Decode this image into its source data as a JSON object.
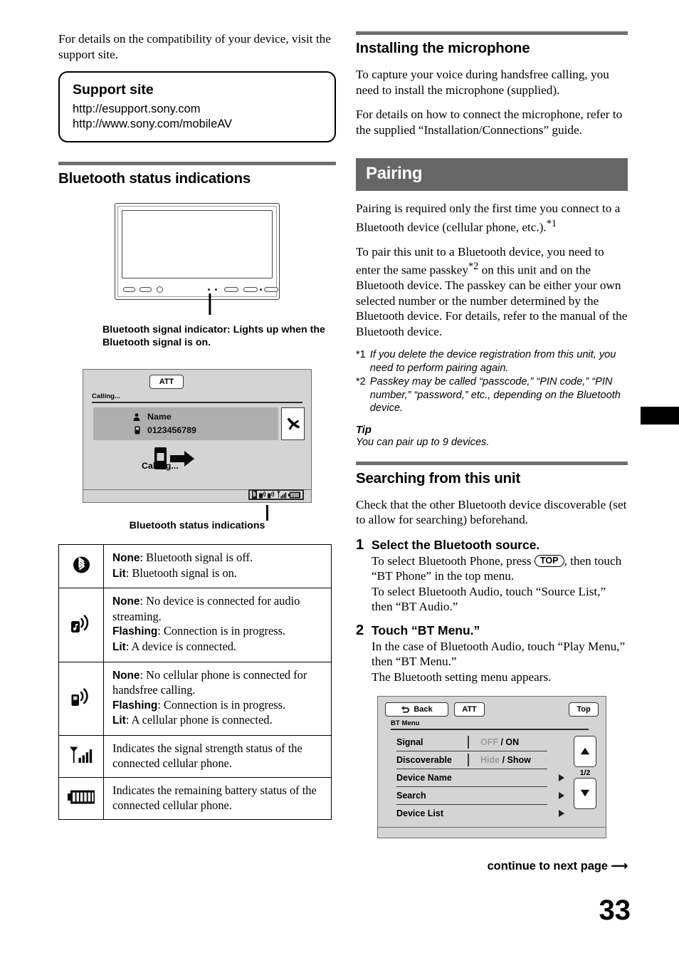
{
  "left": {
    "intro": "For details on the compatibility of your device, visit the support site.",
    "support_box": {
      "title": "Support site",
      "url1": "http://esupport.sony.com",
      "url2": "http://www.sony.com/mobileAV"
    },
    "heading_status": "Bluetooth status indications",
    "unit_caption": "Bluetooth signal indicator: Lights up when the Bluetooth signal is on.",
    "call_screen": {
      "att": "ATT",
      "calling_label": "Calling...",
      "contact_name": "Name",
      "contact_number": "0123456789",
      "calling_word": "Calling..."
    },
    "mock_caption": "Bluetooth status indications",
    "icon_table": [
      {
        "icon": "bluetooth-icon",
        "lines": [
          {
            "bold": "None",
            "rest": ": Bluetooth signal is off."
          },
          {
            "bold": "Lit",
            "rest": ": Bluetooth signal is on."
          }
        ]
      },
      {
        "icon": "bluetooth-audio-streaming-icon",
        "lines": [
          {
            "bold": "None",
            "rest": ": No device is connected for audio streaming."
          },
          {
            "bold": "Flashing",
            "rest": ": Connection is in progress."
          },
          {
            "bold": "Lit",
            "rest": ": A device is connected."
          }
        ]
      },
      {
        "icon": "bluetooth-handsfree-phone-icon",
        "lines": [
          {
            "bold": "None",
            "rest": ": No cellular phone is connected for handsfree calling."
          },
          {
            "bold": "Flashing",
            "rest": ": Connection is in progress."
          },
          {
            "bold": "Lit",
            "rest": ": A cellular phone is connected."
          }
        ]
      },
      {
        "icon": "signal-strength-icon",
        "lines": [
          {
            "bold": "",
            "rest": "Indicates the signal strength status of the connected cellular phone."
          }
        ]
      },
      {
        "icon": "battery-icon",
        "lines": [
          {
            "bold": "",
            "rest": "Indicates the remaining battery status of the connected cellular phone."
          }
        ]
      }
    ]
  },
  "right": {
    "heading_microphone": "Installing the microphone",
    "mic_p1": "To capture your voice during handsfree calling, you need to install the microphone (supplied).",
    "mic_p2": "For details on how to connect the microphone, refer to the supplied “Installation/Connections” guide.",
    "section_pairing": "Pairing",
    "pairing_p1_a": "Pairing is required only the first time you connect to a Bluetooth device (cellular phone, etc.).",
    "pairing_p1_sup": "*1",
    "pairing_p2_a": "To pair this unit to a Bluetooth device, you need to enter the same passkey",
    "pairing_p2_sup": "*2",
    "pairing_p2_b": " on this unit and on the Bluetooth device. The passkey can be either your own selected number or the number determined by the Bluetooth device. For details, refer to the manual of the Bluetooth device.",
    "footnotes": [
      {
        "mark": "*1",
        "text": "If you delete the device registration from this unit, you need to perform pairing again."
      },
      {
        "mark": "*2",
        "text": "Passkey may be called “passcode,” “PIN code,” “PIN number,” “password,” etc., depending on the Bluetooth device."
      }
    ],
    "tip_heading": "Tip",
    "tip_text": "You can pair up to 9 devices.",
    "heading_searching": "Searching from this unit",
    "search_intro": "Check that the other Bluetooth device discoverable (set to allow for searching) beforehand.",
    "steps": [
      {
        "num": "1",
        "title": "Select the Bluetooth source.",
        "text_a": "To select Bluetooth Phone, press ",
        "keycap": "TOP",
        "text_b": ", then touch “BT Phone” in the top menu.",
        "text_c": "To select Bluetooth Audio, touch “Source List,” then “BT Audio.”"
      },
      {
        "num": "2",
        "title": "Touch “BT Menu.”",
        "text_a": "In the case of Bluetooth Audio, touch “Play Menu,” then “BT Menu.”",
        "text_b": "The Bluetooth setting menu appears."
      }
    ],
    "bt_menu": {
      "back": "Back",
      "att": "ATT",
      "top": "Top",
      "title": "BT Menu",
      "page_indicator": "1/2",
      "rows": [
        {
          "label": "Signal",
          "value_off": "OFF",
          "value_sep": " / ",
          "value_on": "ON",
          "arrow": false
        },
        {
          "label": "Discoverable",
          "value_off": "Hide",
          "value_sep": " / ",
          "value_on": "Show",
          "arrow": false
        },
        {
          "label": "Device Name",
          "value_off": "",
          "value_sep": "",
          "value_on": "",
          "arrow": true
        },
        {
          "label": "Search",
          "value_off": "",
          "value_sep": "",
          "value_on": "",
          "arrow": true
        },
        {
          "label": "Device List",
          "value_off": "",
          "value_sep": "",
          "value_on": "",
          "arrow": true
        }
      ]
    }
  },
  "footer": {
    "continue": "continue to next page ⟶",
    "page_number": "33"
  },
  "colors": {
    "section_bar": "#666666",
    "rule": "#6e6e6e",
    "mock_bg": "#d4d4d4",
    "mock_row": "#aeaeae",
    "dim_text": "#9a9a9a"
  }
}
